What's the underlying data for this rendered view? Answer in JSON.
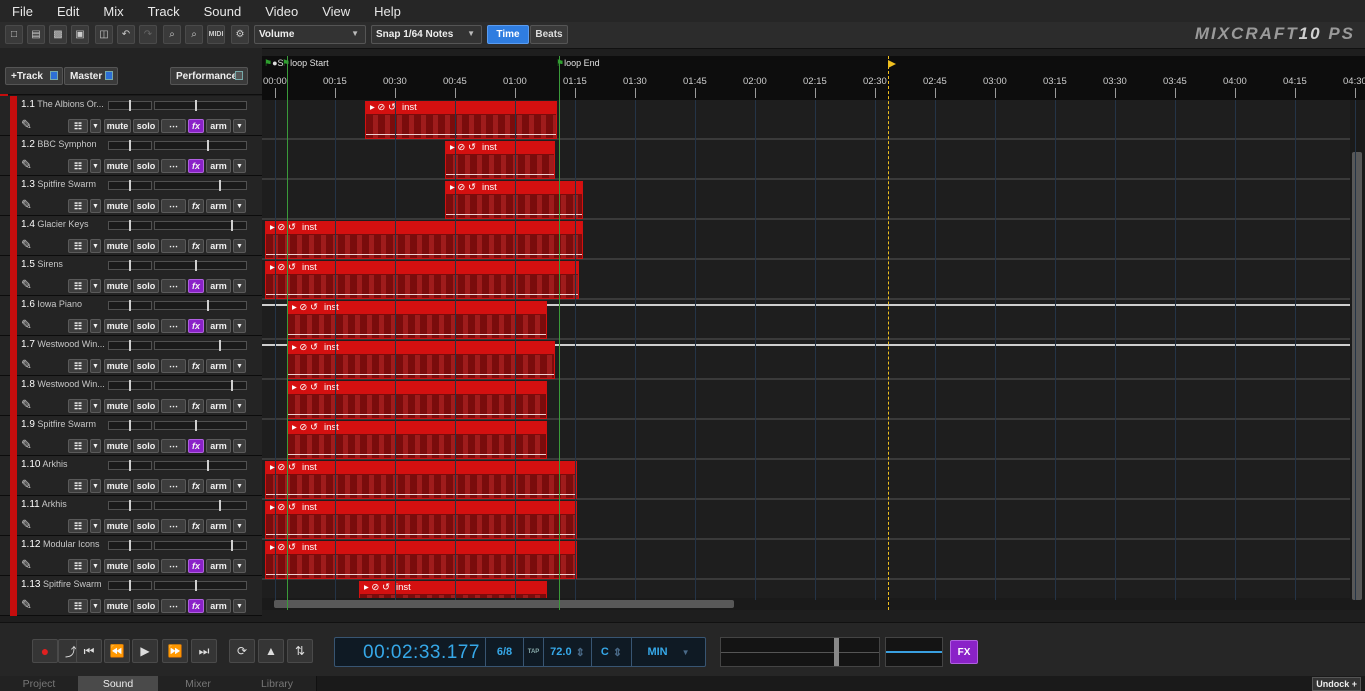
{
  "menubar": {
    "items": [
      "File",
      "Edit",
      "Mix",
      "Track",
      "Sound",
      "Video",
      "View",
      "Help"
    ]
  },
  "toolbar": {
    "automation_select": "Volume",
    "snap_select": "Snap 1/64 Notes",
    "time_label": "Time",
    "beats_label": "Beats",
    "midi_label": "MIDI",
    "logo_text": "MIXCRAFT",
    "logo_version": "10",
    "logo_edition": "PS"
  },
  "left_panel": {
    "add_track": "+Track",
    "master": "Master",
    "performance": "Performance"
  },
  "track_buttons": {
    "mute": "mute",
    "solo": "solo",
    "fx": "fx",
    "arm": "arm"
  },
  "tracks": [
    {
      "num": "1.1",
      "name": "The Albions Or...",
      "fx_active": true
    },
    {
      "num": "1.2",
      "name": "BBC Symphon",
      "fx_active": true
    },
    {
      "num": "1.3",
      "name": "Spitfire Swarm",
      "fx_active": false
    },
    {
      "num": "1.4",
      "name": "Glacier Keys",
      "fx_active": false
    },
    {
      "num": "1.5",
      "name": "Sirens",
      "fx_active": true
    },
    {
      "num": "1.6",
      "name": "Iowa Piano",
      "fx_active": true
    },
    {
      "num": "1.7",
      "name": "Westwood Win...",
      "fx_active": false
    },
    {
      "num": "1.8",
      "name": "Westwood Win...",
      "fx_active": false
    },
    {
      "num": "1.9",
      "name": "Spitfire Swarm",
      "fx_active": true
    },
    {
      "num": "1.10",
      "name": "Arkhis",
      "fx_active": false
    },
    {
      "num": "1.11",
      "name": "Arkhis",
      "fx_active": false
    },
    {
      "num": "1.12",
      "name": "Modular Icons",
      "fx_active": true
    },
    {
      "num": "1.13",
      "name": "Spitfire Swarm",
      "fx_active": true
    }
  ],
  "ruler": {
    "ticks": [
      "00:00",
      "00:15",
      "00:30",
      "00:45",
      "01:00",
      "01:15",
      "01:30",
      "01:45",
      "02:00",
      "02:15",
      "02:30",
      "02:45",
      "03:00",
      "03:15",
      "03:30",
      "03:45",
      "04:00",
      "04:15",
      "04:30"
    ],
    "markers": {
      "song_start": "S",
      "loop_start": "loop Start",
      "loop_end": "loop End"
    }
  },
  "clips": [
    {
      "lane": 0,
      "start_s": 22.5,
      "end_s": 70.5,
      "label": "inst"
    },
    {
      "lane": 1,
      "start_s": 42.5,
      "end_s": 70.0,
      "label": "inst"
    },
    {
      "lane": 2,
      "start_s": 42.5,
      "end_s": 77.0,
      "label": "inst"
    },
    {
      "lane": 3,
      "start_s": -2.5,
      "end_s": 77.0,
      "label": "inst"
    },
    {
      "lane": 4,
      "start_s": -2.5,
      "end_s": 76.0,
      "label": "inst"
    },
    {
      "lane": 5,
      "start_s": 3.0,
      "end_s": 68.0,
      "label": "inst"
    },
    {
      "lane": 6,
      "start_s": 3.0,
      "end_s": 70.0,
      "label": "inst"
    },
    {
      "lane": 7,
      "start_s": 3.0,
      "end_s": 68.0,
      "label": "inst"
    },
    {
      "lane": 8,
      "start_s": 3.0,
      "end_s": 68.0,
      "label": "inst"
    },
    {
      "lane": 9,
      "start_s": -2.5,
      "end_s": 75.5,
      "label": "inst"
    },
    {
      "lane": 10,
      "start_s": -2.5,
      "end_s": 75.5,
      "label": "inst"
    },
    {
      "lane": 11,
      "start_s": -2.5,
      "end_s": 75.5,
      "label": "inst"
    },
    {
      "lane": 12,
      "start_s": 21.0,
      "end_s": 68.0,
      "label": "inst"
    }
  ],
  "playhead_s": 153.177,
  "loop_start_s": 3.0,
  "loop_end_s": 71.0,
  "transport": {
    "time": "00:02:33.177",
    "signature": "6/8",
    "tap": "TAP",
    "tempo": "72.0",
    "key": "C",
    "scale": "MIN",
    "fx": "FX"
  },
  "tabs": [
    "Project",
    "Sound",
    "Mixer",
    "Library"
  ],
  "active_tab": "Sound",
  "undock": "Undock"
}
